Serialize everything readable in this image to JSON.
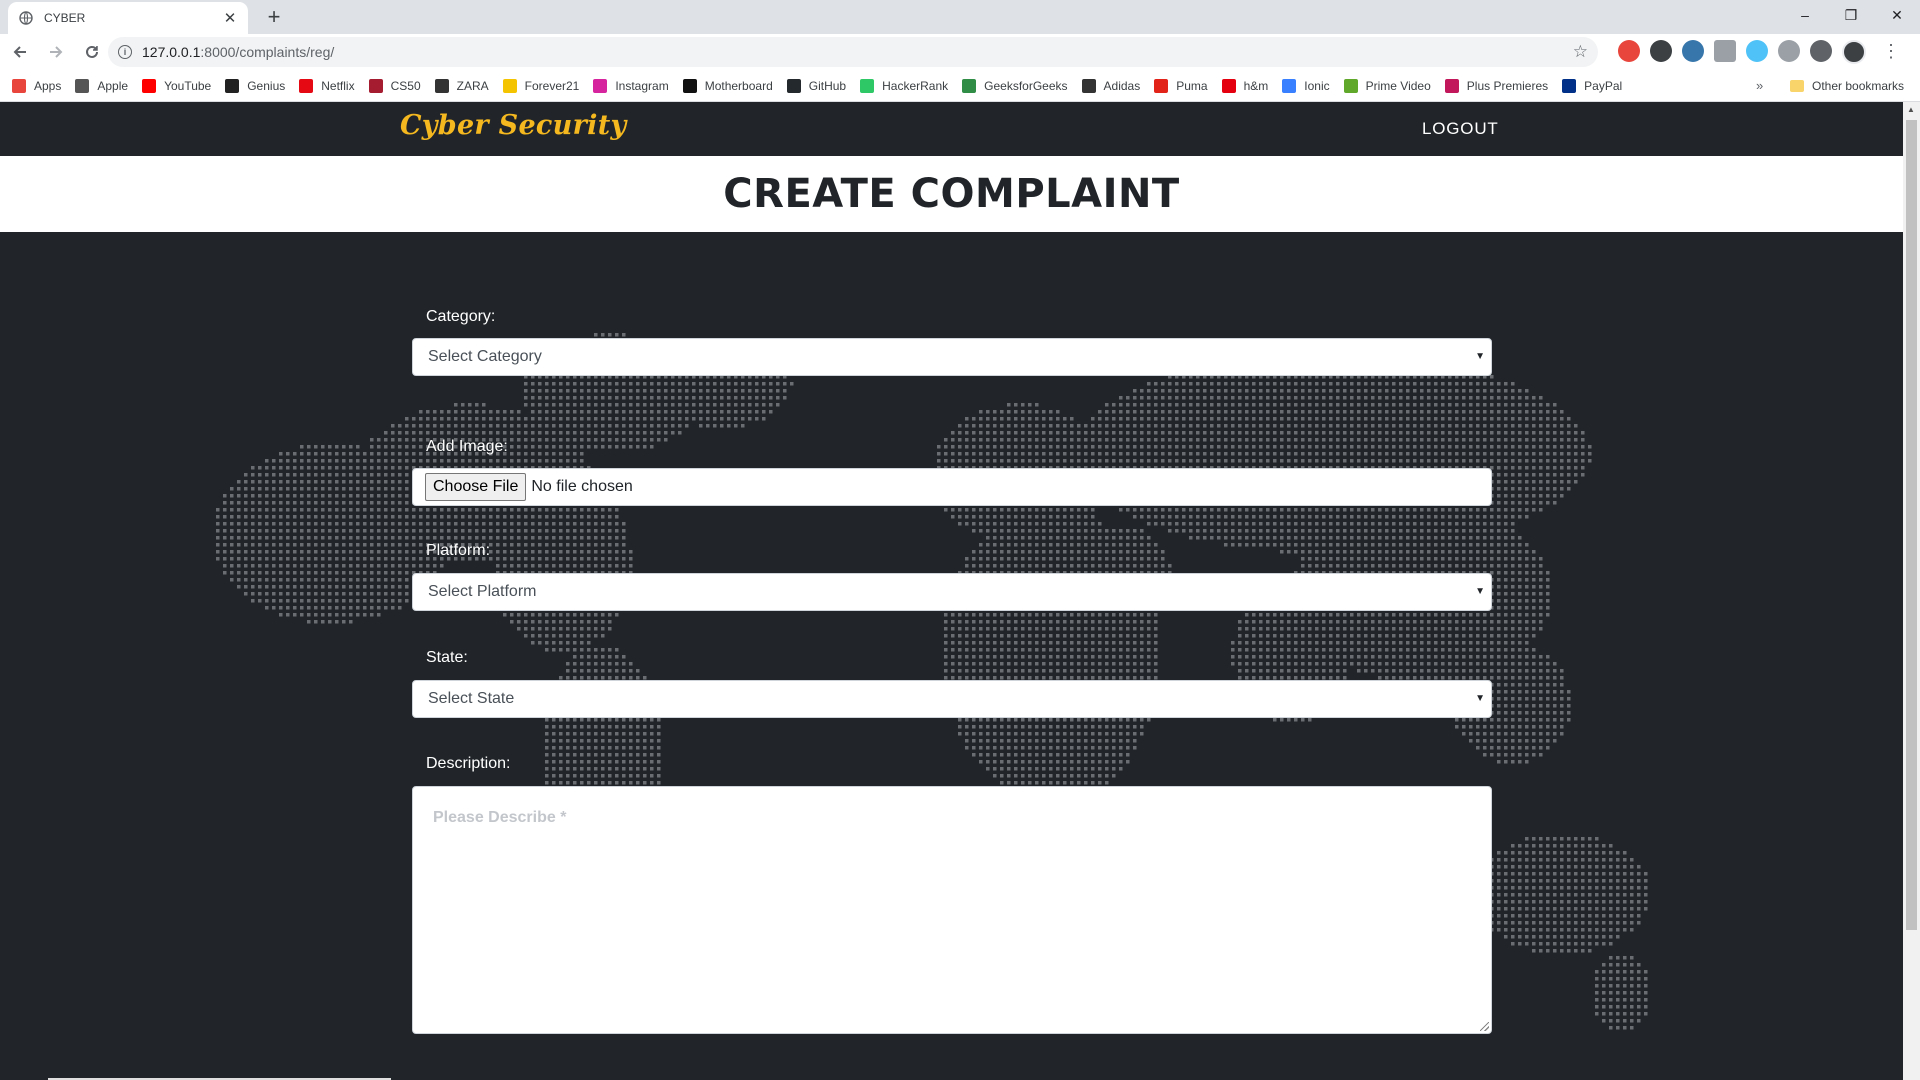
{
  "browser": {
    "tab_title": "CYBER",
    "tab_close": "✕",
    "new_tab": "+",
    "url_host": "127.0.0.1",
    "url_rest": ":8000/complaints/reg/",
    "window_controls": [
      "–",
      "❐",
      "✕"
    ]
  },
  "bookmarks": [
    {
      "label": "Apps",
      "icon": "apps-grid-icon",
      "color": "#e8453c"
    },
    {
      "label": "Apple",
      "icon": "apple-icon",
      "color": "#555555"
    },
    {
      "label": "YouTube",
      "icon": "youtube-icon",
      "color": "#ff0000"
    },
    {
      "label": "Genius",
      "icon": "genius-icon",
      "color": "#222222"
    },
    {
      "label": "Netflix",
      "icon": "netflix-icon",
      "color": "#e50914"
    },
    {
      "label": "CS50",
      "icon": "cs50-icon",
      "color": "#a51c30"
    },
    {
      "label": "ZARA",
      "icon": "zara-icon",
      "color": "#333333"
    },
    {
      "label": "Forever21",
      "icon": "forever21-icon",
      "color": "#f5c400"
    },
    {
      "label": "Instagram",
      "icon": "instagram-icon",
      "color": "#d6249f"
    },
    {
      "label": "Motherboard",
      "icon": "motherboard-icon",
      "color": "#111111"
    },
    {
      "label": "GitHub",
      "icon": "github-icon",
      "color": "#24292e"
    },
    {
      "label": "HackerRank",
      "icon": "hackerrank-icon",
      "color": "#2ec866"
    },
    {
      "label": "GeeksforGeeks",
      "icon": "geeksforgeeks-icon",
      "color": "#2f8d46"
    },
    {
      "label": "Adidas",
      "icon": "adidas-icon",
      "color": "#333333"
    },
    {
      "label": "Puma",
      "icon": "puma-icon",
      "color": "#e2231a"
    },
    {
      "label": "h&m",
      "icon": "hm-icon",
      "color": "#e50010"
    },
    {
      "label": "Ionic",
      "icon": "ionic-icon",
      "color": "#3880ff"
    },
    {
      "label": "Prime Video",
      "icon": "prime-video-icon",
      "color": "#5fa82a"
    },
    {
      "label": "Plus Premieres",
      "icon": "plus-premieres-icon",
      "color": "#c2185b"
    },
    {
      "label": "PayPal",
      "icon": "paypal-icon",
      "color": "#003087"
    }
  ],
  "bookmarks_more": "»",
  "other_bookmarks": "Other bookmarks",
  "site": {
    "brand": "Cyber Security",
    "logout": "LOGOUT",
    "page_title": "CREATE COMPLAINT",
    "brand_color": "#f5b81f",
    "background_color": "#212529"
  },
  "form": {
    "category_label": "Category:",
    "category_value": "Select Category",
    "image_label": "Add Image:",
    "choose_file": "Choose File",
    "file_status": "No file chosen",
    "platform_label": "Platform:",
    "platform_value": "Select Platform",
    "state_label": "State:",
    "state_value": "Select State",
    "description_label": "Description:",
    "description_placeholder": "Please Describe *"
  }
}
